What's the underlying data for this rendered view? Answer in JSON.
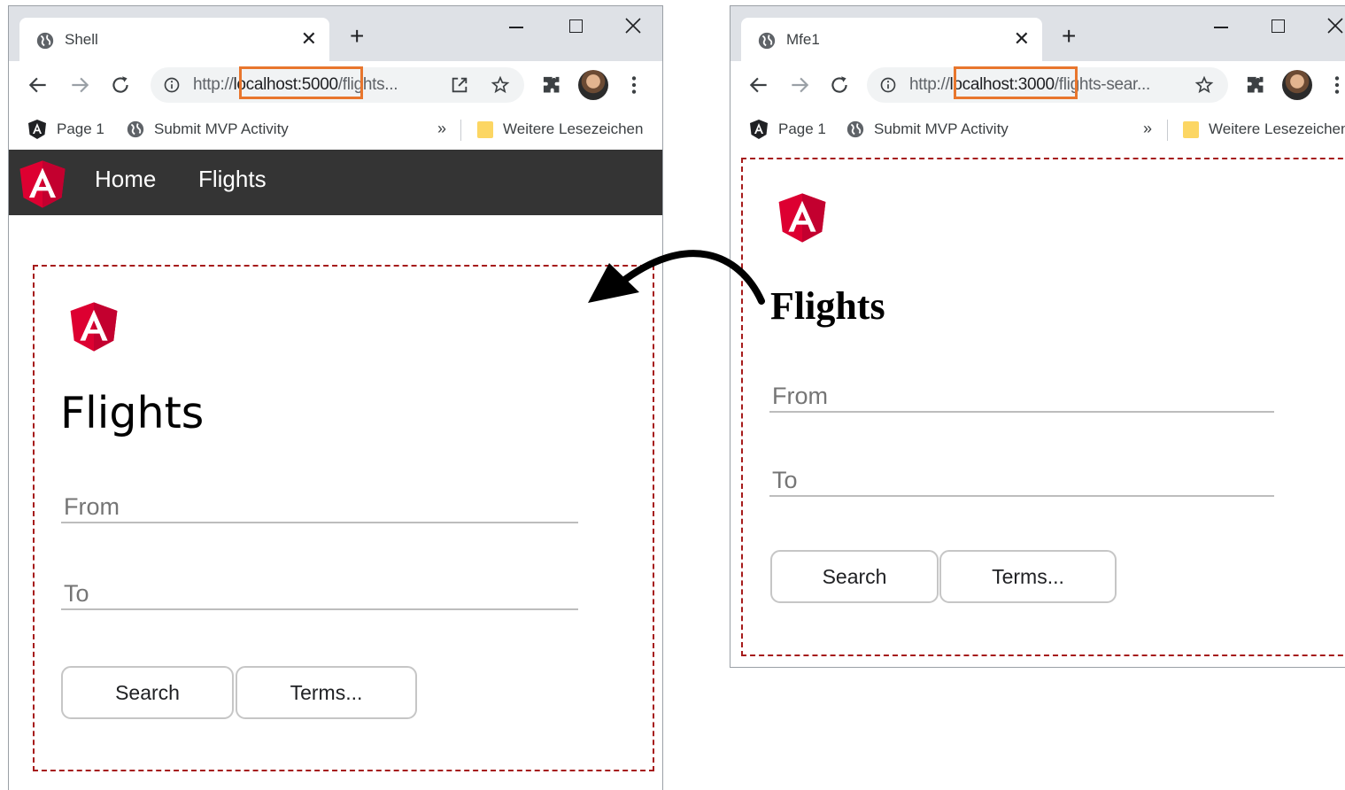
{
  "shell": {
    "tab_title": "Shell",
    "url": {
      "scheme": "http://",
      "host": "localhost:5000",
      "path": "/flights..."
    },
    "bookmarks": {
      "page1": "Page 1",
      "submit": "Submit MVP Activity",
      "more": "»",
      "folder": "Weitere Lesezeichen"
    },
    "nav": {
      "home": "Home",
      "flights": "Flights"
    },
    "content": {
      "title": "Flights",
      "from_placeholder": "From",
      "to_placeholder": "To",
      "search": "Search",
      "terms": "Terms..."
    }
  },
  "mfe1": {
    "tab_title": "Mfe1",
    "url": {
      "scheme": "http://",
      "host": "localhost:3000",
      "path": "/flights-sear..."
    },
    "bookmarks": {
      "page1": "Page 1",
      "submit": "Submit MVP Activity",
      "more": "»",
      "folder": "Weitere Lesezeichen"
    },
    "content": {
      "title": "Flights",
      "from_placeholder": "From",
      "to_placeholder": "To",
      "search": "Search",
      "terms": "Terms..."
    }
  },
  "colors": {
    "url_highlight": "#e8762d",
    "frame_border": "#a61b1b",
    "navbar": "#343434",
    "angular_red": "#dd0031"
  },
  "icons": [
    "globe-icon",
    "close-icon",
    "plus-icon",
    "back-icon",
    "forward-icon",
    "reload-icon",
    "info-icon",
    "open-in-new-icon",
    "star-icon",
    "extensions-icon",
    "menu-icon",
    "angular-icon",
    "folder-icon",
    "arrow-icon"
  ]
}
